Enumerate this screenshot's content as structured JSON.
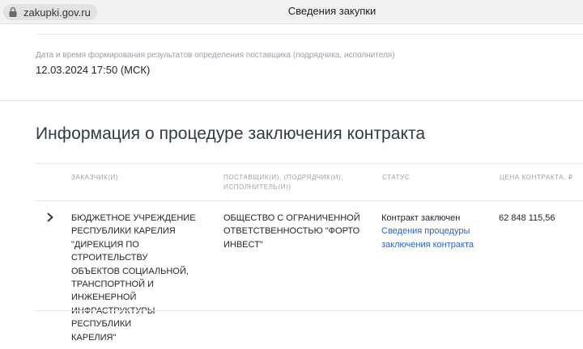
{
  "browser": {
    "url": "zakupki.gov.ru",
    "page_title": "Сведения закупки",
    "lock_icon": "lock-icon"
  },
  "meta": {
    "label": "Дата и время формирования результатов определения поставщика (подрядчика, исполнителя)",
    "value": "12.03.2024 17:50 (МСК)"
  },
  "section": {
    "heading": "Информация о процедуре заключения контракта"
  },
  "table": {
    "headers": {
      "customer": [
        "ЗАКАЗЧИК(И)"
      ],
      "supplier": [
        "ПОСТАВЩИК(И), (ПОДРЯДЧИК(И),",
        "ИСПОЛНИТЕЛЬ(И))"
      ],
      "status": [
        "СТАТУС"
      ],
      "price": [
        "ЦЕНА КОНТРАКТА, ₽"
      ]
    },
    "rows": [
      {
        "expand_icon": "chevron-right-icon",
        "customer_lines": [
          "БЮДЖЕТНОЕ УЧРЕЖДЕНИЕ",
          "РЕСПУБЛИКИ КАРЕЛИЯ",
          "\"ДИРЕКЦИЯ ПО СТРОИТЕЛЬСТВУ",
          "ОБЪЕКТОВ СОЦИАЛЬНОЙ,",
          "ТРАНСПОРТНОЙ И ИНЖЕНЕРНОЙ",
          "ИНФРАСТРУКТУРЫ РЕСПУБЛИКИ",
          "КАРЕЛИЯ\""
        ],
        "supplier_lines": [
          "ОБЩЕСТВО С ОГРАНИЧЕННОЙ",
          "ОТВЕТСТВЕННОСТЬЮ \"ФОРТО",
          "ИНВЕСТ\""
        ],
        "status_text": "Контракт заключен",
        "status_link_lines": [
          "Сведения процедуры",
          "заключения контракта"
        ],
        "price": "62 848 115,56"
      }
    ]
  },
  "colors": {
    "link": "#2a62c9",
    "muted": "#9aa1ab",
    "heading": "#323a45"
  }
}
